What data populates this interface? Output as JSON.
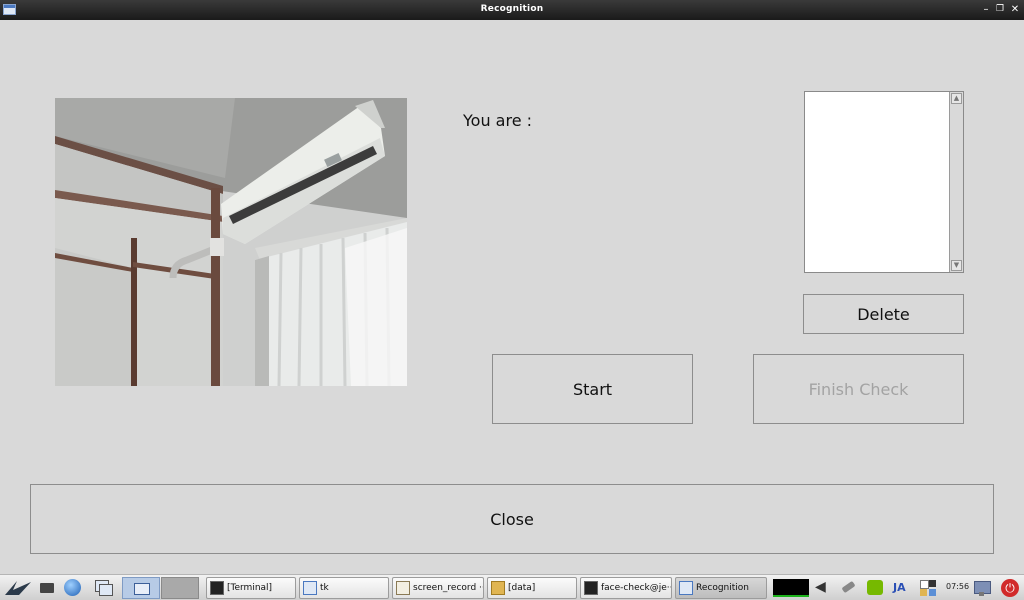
{
  "window": {
    "title": "Recognition"
  },
  "main": {
    "you_are_label": "You are :",
    "buttons": {
      "delete": "Delete",
      "start": "Start",
      "finish_check": "Finish Check",
      "close": "Close"
    },
    "listbox": {
      "items": []
    },
    "colors": {
      "disabled_text": "#a3a3a3",
      "window_bg": "#d9d9d9"
    }
  },
  "taskbar": {
    "tasks": [
      {
        "label": "[Terminal]",
        "icon": "terminal-icon"
      },
      {
        "label": "tk",
        "icon": "window-icon"
      },
      {
        "label": "screen_record ···",
        "icon": "text-editor-icon"
      },
      {
        "label": "[data]",
        "icon": "folder-icon"
      },
      {
        "label": "face-check@je···",
        "icon": "terminal-icon"
      },
      {
        "label": "Recognition",
        "icon": "window-icon",
        "active": true
      }
    ],
    "tray_lang": "JA",
    "clock": "07:56"
  }
}
